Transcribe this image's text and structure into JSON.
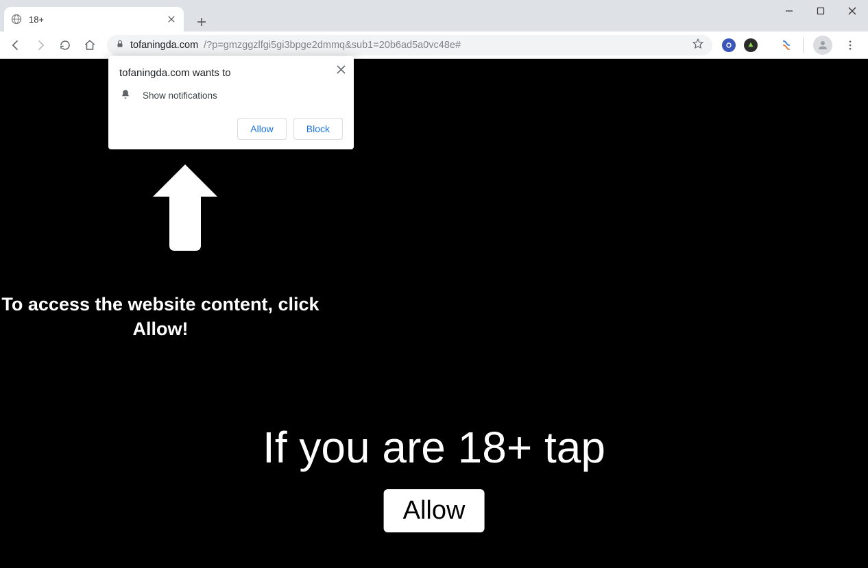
{
  "tab": {
    "title": "18+"
  },
  "address": {
    "host": "tofaningda.com",
    "rest": "/?p=gmzggzlfgi5gi3bpge2dmmq&sub1=20b6ad5a0vc48e#"
  },
  "permission": {
    "title": "tofaningda.com wants to",
    "item": "Show notifications",
    "allow": "Allow",
    "block": "Block"
  },
  "page": {
    "instruction": "To access the website content, click Allow!",
    "headline": "If you are 18+ tap",
    "button": "Allow"
  }
}
